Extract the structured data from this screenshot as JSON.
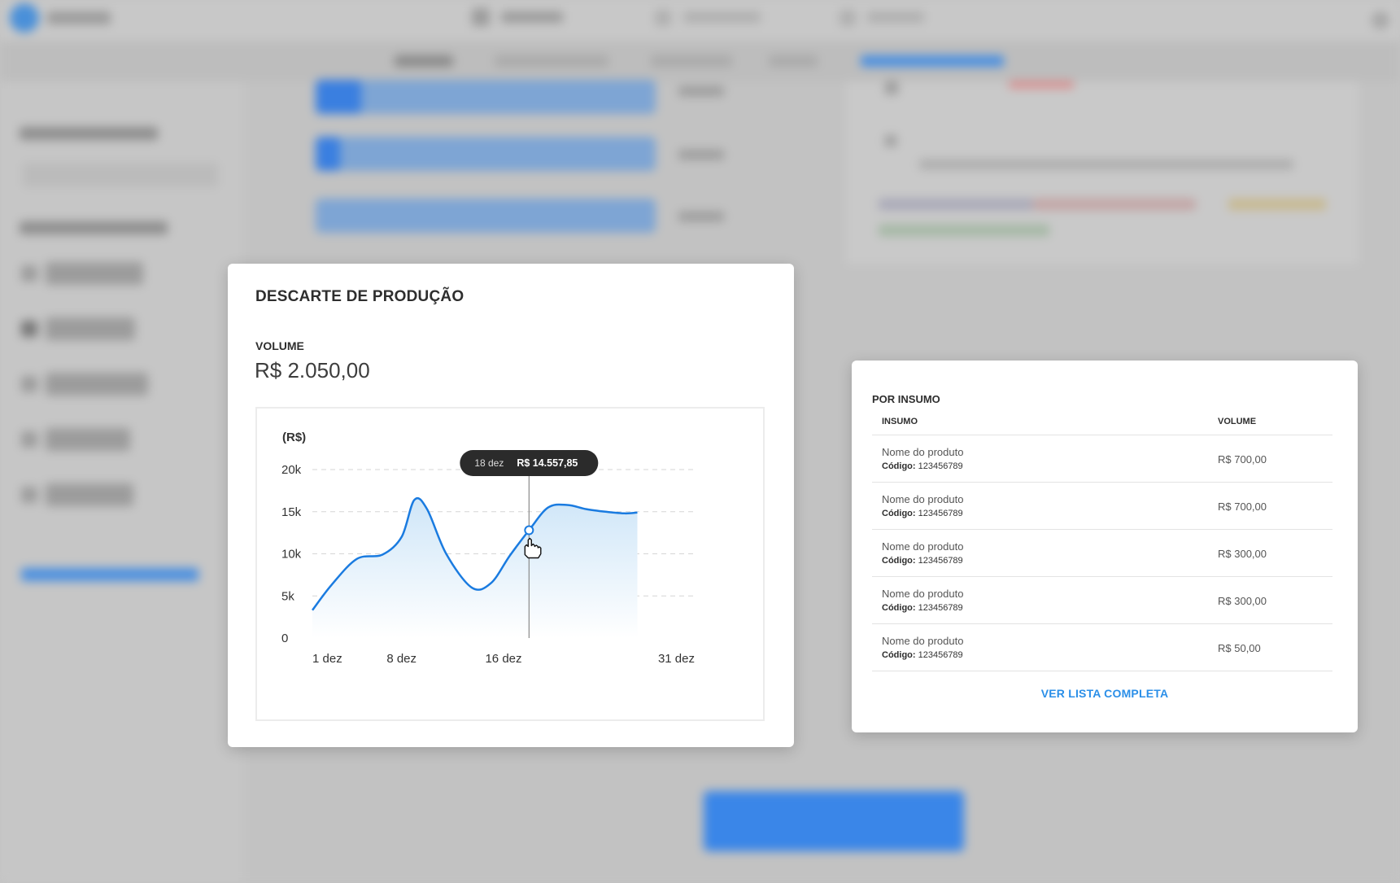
{
  "chart_card": {
    "title": "DESCARTE DE PRODUÇÃO",
    "volume_label": "VOLUME",
    "volume_value": "R$ 2.050,00"
  },
  "chart_data": {
    "type": "area",
    "ylabel": "(R$)",
    "ylim": [
      0,
      20000
    ],
    "yticks": [
      0,
      5000,
      10000,
      15000,
      20000
    ],
    "ytick_labels": [
      "0",
      "5k",
      "10k",
      "15k",
      "20k"
    ],
    "xlim": [
      1,
      31
    ],
    "xticks": [
      1,
      8,
      16,
      31
    ],
    "xtick_labels": [
      "1 dez",
      "8 dez",
      "16 dez",
      "31 dez"
    ],
    "grid": true,
    "series": [
      {
        "x": [
          1,
          2.5,
          4.5,
          6.5,
          8,
          9,
          10,
          11.5,
          13.5,
          15,
          16.5,
          18,
          19.5,
          21,
          22.5,
          24,
          25.5,
          26.5
        ],
        "y": [
          3300,
          6300,
          9400,
          9900,
          12000,
          16400,
          15300,
          10000,
          6000,
          6500,
          9800,
          12800,
          15500,
          15800,
          15300,
          15000,
          14800,
          14900
        ]
      }
    ],
    "tooltip": {
      "x": 18,
      "date_label": "18 dez",
      "value_label": "R$ 14.557,85"
    },
    "line_color": "#1a7be0",
    "fill_color": "#cfe6f8"
  },
  "table_card": {
    "title": "POR INSUMO",
    "columns": [
      "INSUMO",
      "VOLUME"
    ],
    "code_label": "Código:",
    "rows": [
      {
        "name": "Nome do produto",
        "code": "123456789",
        "volume": "R$ 700,00"
      },
      {
        "name": "Nome do produto",
        "code": "123456789",
        "volume": "R$ 700,00"
      },
      {
        "name": "Nome do produto",
        "code": "123456789",
        "volume": "R$ 300,00"
      },
      {
        "name": "Nome do produto",
        "code": "123456789",
        "volume": "R$ 300,00"
      },
      {
        "name": "Nome do produto",
        "code": "123456789",
        "volume": "R$ 50,00"
      }
    ],
    "link_label": "VER LISTA COMPLETA"
  }
}
